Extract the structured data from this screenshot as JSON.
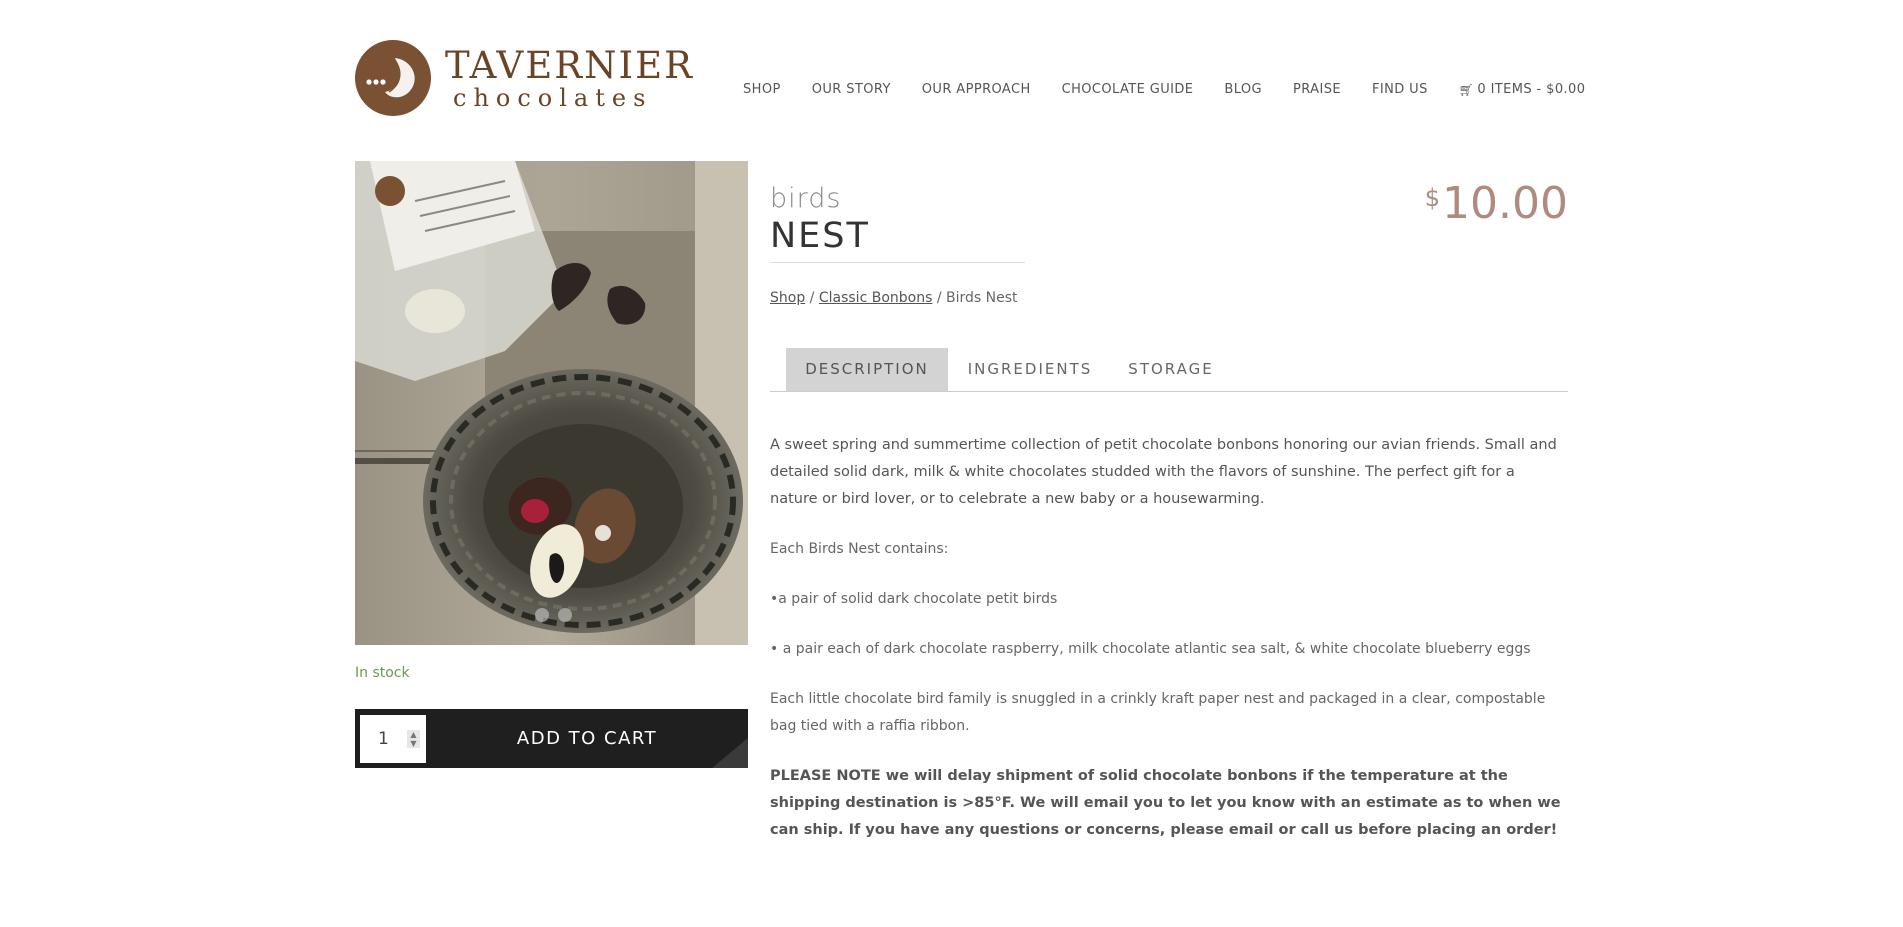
{
  "brand": {
    "name_line1": "TAVERNIER",
    "name_line2": "chocolates",
    "color": "#6b4426"
  },
  "nav": {
    "items": [
      "SHOP",
      "OUR STORY",
      "OUR APPROACH",
      "CHOCOLATE GUIDE",
      "BLOG",
      "PRAISE",
      "FIND US"
    ],
    "cart_label": "0 ITEMS - $0.00"
  },
  "product": {
    "subtitle": "birds",
    "title": "NEST",
    "price_currency": "$",
    "price_amount": "10.00",
    "stock_status": "In stock",
    "quantity": "1",
    "add_to_cart_label": "ADD TO CART",
    "image_dots": 2
  },
  "breadcrumb": {
    "shop": "Shop",
    "sep": "/",
    "category": "Classic Bonbons",
    "current": "Birds Nest"
  },
  "tabs": [
    "DESCRIPTION",
    "INGREDIENTS",
    "STORAGE"
  ],
  "description": {
    "intro": "A sweet spring and summertime collection of petit chocolate bonbons honoring our avian friends. Small and detailed solid dark, milk & white chocolates studded with the flavors of sunshine. The perfect gift for a nature or bird lover, or to celebrate a new baby or a housewarming.",
    "contains": "Each Birds Nest contains:",
    "bullet1": "•a pair of solid dark chocolate petit birds",
    "bullet2": "• a pair each of dark chocolate raspberry, milk chocolate atlantic sea salt, & white chocolate blueberry eggs",
    "packaging": "Each little chocolate bird family is snuggled in a crinkly kraft paper nest and  packaged in a clear, compostable bag tied with a raffia ribbon.",
    "note": "PLEASE NOTE we will delay shipment of solid chocolate bonbons if the temperature at the shipping destination is >85°F. We will email you to let you know with an estimate as to when we can ship. If you have any questions or concerns, please email or call us before placing an order!"
  },
  "colors": {
    "price": "#b08a7e",
    "stock": "#6a9a4a",
    "cart_bar": "#1f1f1f",
    "tab_active": "#d3d3d3"
  }
}
